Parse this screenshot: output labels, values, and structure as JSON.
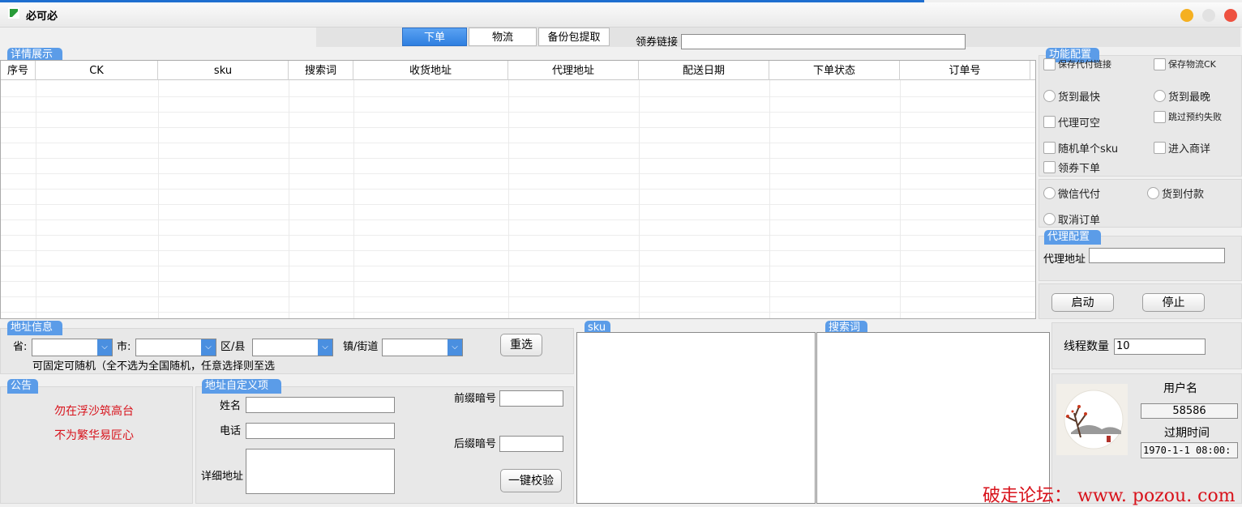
{
  "app": {
    "title": "必可必"
  },
  "tabs": [
    {
      "label": "下单",
      "active": true
    },
    {
      "label": "物流",
      "active": false
    },
    {
      "label": "备份包提取",
      "active": false
    }
  ],
  "coupon": {
    "label": "领券链接",
    "value": ""
  },
  "detail": {
    "group_label": "详情展示",
    "columns": [
      "序号",
      "CK",
      "sku",
      "搜索词",
      "收货地址",
      "代理地址",
      "配送日期",
      "下单状态",
      "订单号"
    ]
  },
  "features": {
    "group_label": "功能配置",
    "options": [
      {
        "label": "保存代付链接",
        "kind": "checkbox"
      },
      {
        "label": "保存物流CK",
        "kind": "checkbox"
      },
      {
        "label": "货到最快",
        "kind": "radio"
      },
      {
        "label": "货到最晚",
        "kind": "radio"
      },
      {
        "label": "代理可空",
        "kind": "checkbox"
      },
      {
        "label": "跳过预约失败",
        "kind": "checkbox"
      },
      {
        "label": "随机单个sku",
        "kind": "checkbox"
      },
      {
        "label": "进入商详",
        "kind": "checkbox"
      },
      {
        "label": "领券下单",
        "kind": "checkbox"
      }
    ],
    "pay_options": [
      {
        "label": "微信代付"
      },
      {
        "label": "货到付款"
      },
      {
        "label": "取消订单"
      }
    ]
  },
  "proxy": {
    "group_label": "代理配置",
    "label": "代理地址",
    "value": ""
  },
  "controls": {
    "start": "启动",
    "stop": "停止"
  },
  "address_info": {
    "group_label": "地址信息",
    "province_label": "省:",
    "city_label": "市:",
    "district_label": "区/县",
    "street_label": "镇/街道",
    "reset_button": "重选",
    "hint": "可固定可随机（全不选为全国随机，任意选择则至选"
  },
  "notice": {
    "group_label": "公告",
    "lines": [
      "勿在浮沙筑高台",
      "不为繁华易匠心"
    ]
  },
  "custom_address": {
    "group_label": "地址自定义项",
    "name_label": "姓名",
    "phone_label": "电话",
    "detail_label": "详细地址",
    "prefix_label": "前缀暗号",
    "suffix_label": "后缀暗号",
    "verify_button": "一键校验"
  },
  "sku_box": {
    "group_label": "sku"
  },
  "search_box": {
    "group_label": "搜索词"
  },
  "threads": {
    "label": "线程数量",
    "value": "10"
  },
  "user": {
    "username_label": "用户名",
    "username_value": "58586",
    "expiry_label": "过期时间",
    "expiry_value": "1970-1-1 08:00:"
  },
  "watermark": {
    "text": "破走论坛： www. pozou. com"
  },
  "colors": {
    "accent": "#5b9ce8",
    "red_text": "#d8121b"
  }
}
